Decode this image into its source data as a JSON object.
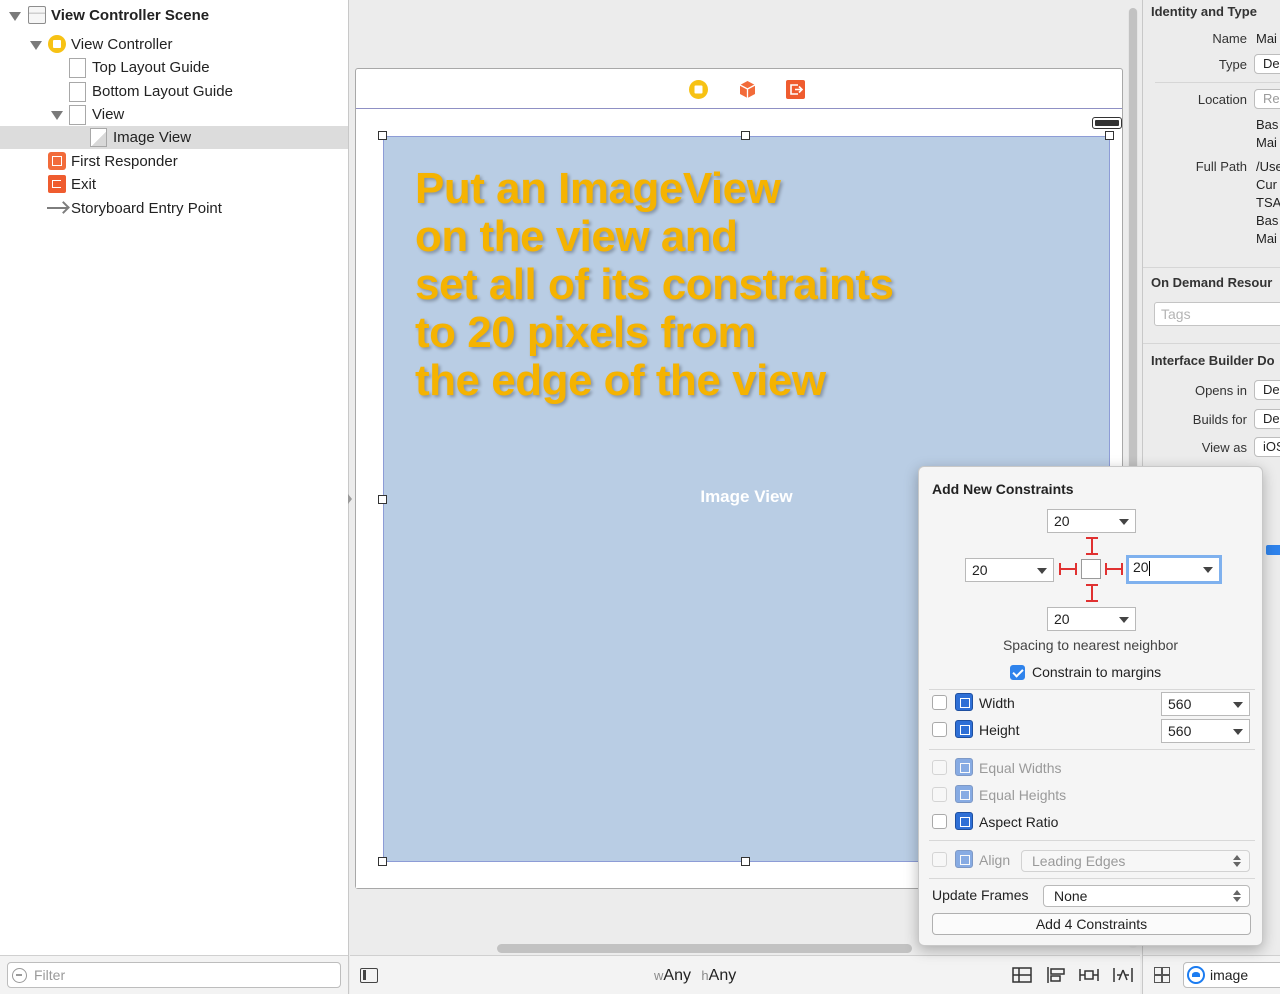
{
  "outline": {
    "items": [
      {
        "label": "View Controller Scene",
        "icon": "scene-icon"
      },
      {
        "label": "View Controller",
        "icon": "view-controller-icon"
      },
      {
        "label": "Top Layout Guide",
        "icon": "layout-guide-icon"
      },
      {
        "label": "Bottom Layout Guide",
        "icon": "layout-guide-icon"
      },
      {
        "label": "View",
        "icon": "view-icon"
      },
      {
        "label": "Image View",
        "icon": "image-view-icon",
        "selected": true
      },
      {
        "label": "First Responder",
        "icon": "first-responder-icon"
      },
      {
        "label": "Exit",
        "icon": "exit-icon"
      },
      {
        "label": "Storyboard Entry Point",
        "icon": "entry-point-arrow-icon"
      }
    ],
    "filter_placeholder": "Filter"
  },
  "canvas": {
    "image_view_label": "Image View",
    "overlay_lines": [
      "Put an ImageView",
      "on the view and",
      "set all of its constraints",
      "to 20 pixels from",
      "the edge of the view"
    ]
  },
  "bottom_bar": {
    "width_prefix": "w",
    "width_value": "Any",
    "height_prefix": "h",
    "height_value": "Any"
  },
  "popover": {
    "title": "Add New Constraints",
    "top": "20",
    "left": "20",
    "right": "20",
    "bottom": "20",
    "spacing_label": "Spacing to nearest neighbor",
    "constrain_to_margins": "Constrain to margins",
    "width_label": "Width",
    "width_value": "560",
    "height_label": "Height",
    "height_value": "560",
    "equal_widths": "Equal Widths",
    "equal_heights": "Equal Heights",
    "aspect_ratio": "Aspect Ratio",
    "align_label": "Align",
    "align_value": "Leading Edges",
    "update_frames_label": "Update Frames",
    "update_frames_value": "None",
    "add_button": "Add 4 Constraints"
  },
  "inspector": {
    "identity_title": "Identity and Type",
    "name_label": "Name",
    "name_value": "Mai",
    "type_label": "Type",
    "type_value": "De",
    "location_label": "Location",
    "location_value": "Re",
    "location_lines": [
      "Bas",
      "Mai"
    ],
    "full_path_label": "Full Path",
    "full_path_lines": [
      "/Use",
      "Cur",
      "TSA",
      "Bas",
      "Mai"
    ],
    "on_demand_title": "On Demand Resour",
    "tags_placeholder": "Tags",
    "ib_title": "Interface Builder Do",
    "opens_in_label": "Opens in",
    "opens_in_value": "De",
    "builds_for_label": "Builds for",
    "builds_for_value": "De",
    "view_as_label": "View as",
    "view_as_value": "iOS",
    "library_search": "image"
  },
  "colors": {
    "overlay_text": "#f5b301",
    "image_view_fill": "#b9cde4",
    "strut_red": "#e03131",
    "focus_blue": "#7fb1ee"
  }
}
